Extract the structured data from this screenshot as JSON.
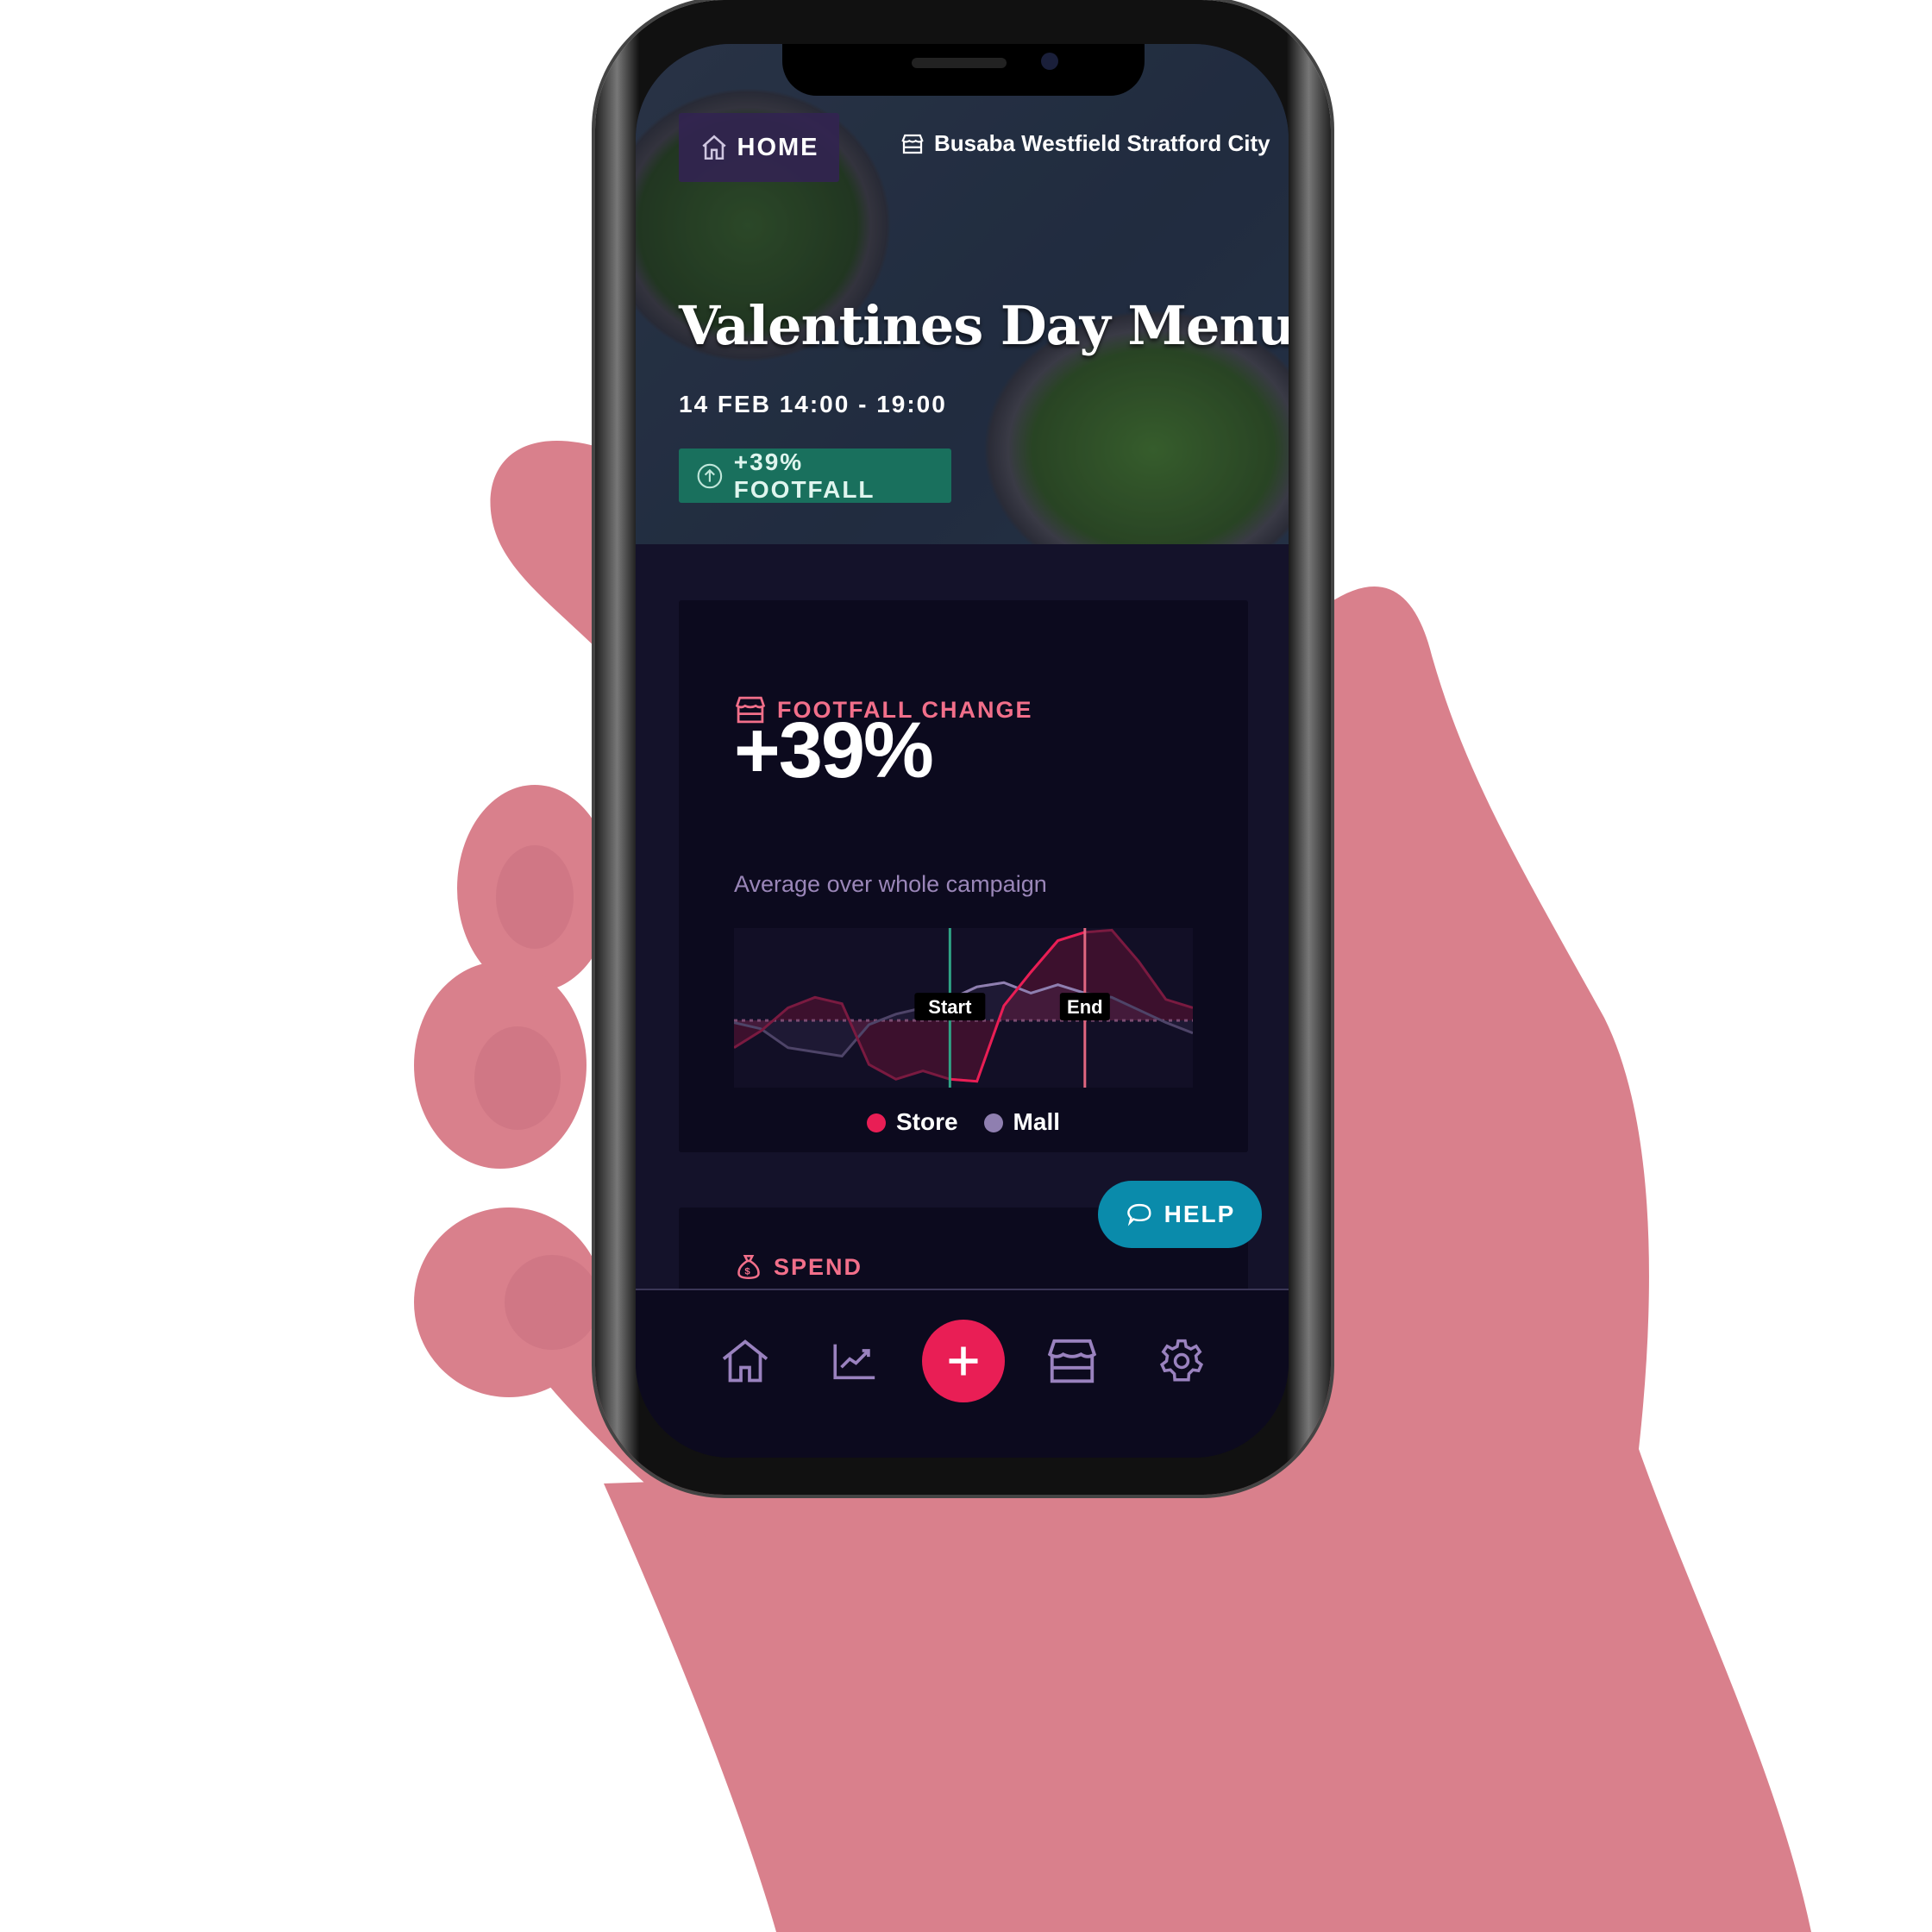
{
  "header": {
    "home_label": "HOME",
    "location": "Busaba Westfield Stratford City"
  },
  "campaign": {
    "title": "Valentines Day Menu",
    "date": "14 FEB 14:00 - 19:00",
    "badge": "+39% FOOTFALL"
  },
  "footfall_card": {
    "title": "FOOTFALL CHANGE",
    "value": "+39%",
    "subtitle": "Average over whole campaign"
  },
  "spend_card": {
    "title": "SPEND"
  },
  "help_label": "HELP",
  "nav": {
    "items": [
      "home",
      "insights",
      "add",
      "store",
      "settings"
    ]
  },
  "colors": {
    "accent": "#e91e55",
    "teal": "#1a7a60",
    "help": "#0a8bab",
    "mall": "#8f7fb0",
    "title": "#f26f8a"
  },
  "chart_data": {
    "type": "line",
    "x": [
      0,
      1,
      2,
      3,
      4,
      5,
      6,
      7,
      8,
      9,
      10,
      11,
      12,
      13,
      14,
      15,
      16,
      17
    ],
    "series": [
      {
        "name": "Store",
        "color": "#e91e55",
        "values": [
          -13,
          -5,
          6,
          11,
          8,
          -21,
          -28,
          -24,
          -28,
          -29,
          7,
          23,
          38,
          42,
          43,
          28,
          10,
          6
        ]
      },
      {
        "name": "Mall",
        "color": "#8f7fb0",
        "values": [
          -1,
          -4,
          -13,
          -15,
          -17,
          -2,
          3,
          6,
          10,
          16,
          18,
          13,
          17,
          13,
          11,
          5,
          -1,
          -6
        ]
      }
    ],
    "markers": [
      {
        "label": "Start",
        "x": 8,
        "color": "#2fa385"
      },
      {
        "label": "End",
        "x": 13,
        "color": "#e06680"
      }
    ],
    "baseline": 0,
    "ylim": [
      -32,
      44
    ],
    "legend": "bottom"
  }
}
